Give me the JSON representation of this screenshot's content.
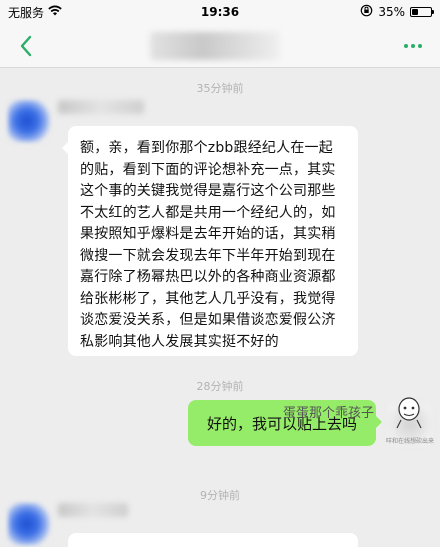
{
  "status_bar": {
    "carrier": "无服务",
    "time": "19:36",
    "battery_percent": "35%",
    "battery_level": 0.35
  },
  "nav": {
    "back_icon": "chevron-left-icon",
    "more_icon": "more-dots-icon",
    "accent_color": "#2aae67"
  },
  "messages": [
    {
      "timestamp": "35分钟前",
      "side": "left",
      "text": "额，亲，看到你那个zbb跟经纪人在一起的贴，看到下面的评论想补充一点，其实这个事的关键我觉得是嘉行这个公司那些不太红的艺人都是共用一个经纪人的，如果按照知乎爆料是去年开始的话，其实稍微搜一下就会发现去年下半年开始到现在嘉行除了杨幂热巴以外的各种商业资源都给张彬彬了，其他艺人几乎没有，我觉得谈恋爱没关系，但是如果借谈恋爱假公济私影响其他人发展其实挺不好的"
    },
    {
      "timestamp": "28分钟前",
      "side": "right",
      "text": "好的，我可以贴上去吗"
    },
    {
      "timestamp": "9分钟前",
      "side": "left",
      "text": ""
    }
  ],
  "watermark": {
    "text": "蛋蛋那个乖孩子",
    "caption": "咩和在线想砍出来"
  },
  "colors": {
    "background": "#ededed",
    "bubble_incoming": "#ffffff",
    "bubble_outgoing": "#95ec69"
  }
}
